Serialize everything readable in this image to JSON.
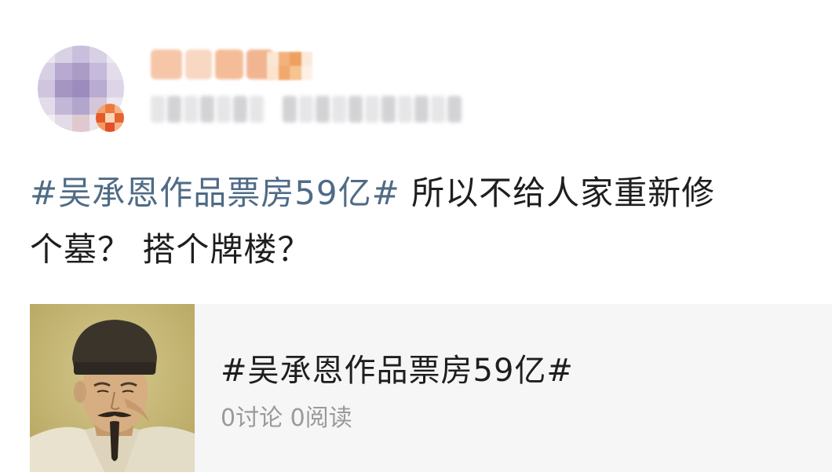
{
  "post": {
    "hashtag": "#吴承恩作品票房59亿#",
    "body_line1": " 所以不给人家重新修",
    "body_line2": "个墓？ 搭个牌楼？"
  },
  "topic_card": {
    "title": "#吴承恩作品票房59亿#",
    "discussions_count": "0",
    "discussions_label": "讨论",
    "reads_count": "0",
    "reads_label": "阅读"
  },
  "icons": {
    "avatar": "avatar-icon",
    "verified_badge": "verified-badge-icon",
    "thumbnail": "portrait-thumbnail"
  },
  "colors": {
    "hashtag": "#4f6b86",
    "text": "#1e1e1e",
    "muted": "#9a9a9a",
    "card_bg": "#f6f6f6"
  }
}
